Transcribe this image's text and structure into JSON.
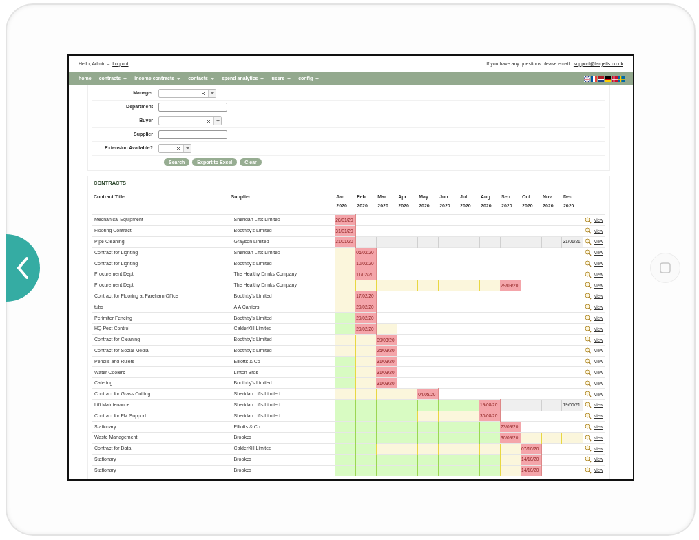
{
  "header": {
    "greeting": "Hello, Admin –",
    "logout": "Log out",
    "help_text": "If you have any questions please email:",
    "email": "support@targetis.co.uk"
  },
  "nav": [
    {
      "label": "home",
      "dropdown": false
    },
    {
      "label": "contracts",
      "dropdown": true
    },
    {
      "label": "income contracts",
      "dropdown": true
    },
    {
      "label": "contacts",
      "dropdown": true
    },
    {
      "label": "spend analytics",
      "dropdown": true
    },
    {
      "label": "users",
      "dropdown": true
    },
    {
      "label": "config",
      "dropdown": true
    }
  ],
  "filters": [
    {
      "label": "Manager",
      "kind": "select"
    },
    {
      "label": "Department",
      "kind": "text"
    },
    {
      "label": "Buyer",
      "kind": "select"
    },
    {
      "label": "Supplier",
      "kind": "text"
    },
    {
      "label": "Extension Available?",
      "kind": "short_select"
    }
  ],
  "buttons": [
    "Search",
    "Export to Excel",
    "Clear"
  ],
  "contracts": {
    "title": "CONTRACTS",
    "columns": [
      "Contract Title",
      "Supplier"
    ],
    "months": [
      {
        "month": "Jan",
        "year": "2020"
      },
      {
        "month": "Feb",
        "year": "2020"
      },
      {
        "month": "Mar",
        "year": "2020"
      },
      {
        "month": "Apr",
        "year": "2020"
      },
      {
        "month": "May",
        "year": "2020"
      },
      {
        "month": "Jun",
        "year": "2020"
      },
      {
        "month": "Jul",
        "year": "2020"
      },
      {
        "month": "Aug",
        "year": "2020"
      },
      {
        "month": "Sep",
        "year": "2020"
      },
      {
        "month": "Oct",
        "year": "2020"
      },
      {
        "month": "Nov",
        "year": "2020"
      },
      {
        "month": "Dec",
        "year": "2020"
      }
    ],
    "rows": [
      {
        "title": "Mechanical Equipment",
        "supplier": "Sheridan Lifts Limited",
        "cells": [
          {
            "color": "#f4a5aa",
            "text": "28/01/20"
          }
        ],
        "link": "view"
      },
      {
        "title": "Flooring Contract",
        "supplier": "Boothby's Limited",
        "cells": [
          {
            "color": "#f4a5aa",
            "text": "31/01/20"
          }
        ],
        "link": "view"
      },
      {
        "title": "Pipe Cleaning",
        "supplier": "Grayson Limited",
        "cells": [
          {
            "color": "#f4a5aa",
            "text": "31/01/20"
          },
          {
            "color": "#efefef"
          },
          {
            "color": "#efefef"
          },
          {
            "color": "#efefef"
          },
          {
            "color": "#efefef"
          },
          {
            "color": "#efefef"
          },
          {
            "color": "#efefef"
          },
          {
            "color": "#efefef"
          },
          {
            "color": "#efefef"
          },
          {
            "color": "#efefef"
          },
          {
            "color": "#efefef"
          },
          {
            "color": "#efefef",
            "text": "31/01/21"
          }
        ],
        "link": "view"
      },
      {
        "title": "Contract for Lighting",
        "supplier": "Sheridan Lifts Limited",
        "cells": [
          {
            "color": "#fbf6dc"
          },
          {
            "color": "#f4a5aa",
            "text": "06/02/20"
          }
        ],
        "link": "view"
      },
      {
        "title": "Contract for Lighting",
        "supplier": "Boothby's Limited",
        "cells": [
          {
            "color": "#fbf6dc"
          },
          {
            "color": "#f4a5aa",
            "text": "10/02/20"
          }
        ],
        "link": "view"
      },
      {
        "title": "Procurement Dept",
        "supplier": "The Healthy Drinks Company",
        "cells": [
          {
            "color": "#fbf6dc"
          },
          {
            "color": "#f4a5aa",
            "text": "11/02/20"
          }
        ],
        "link": "view"
      },
      {
        "title": "Procurement Dept",
        "supplier": "The Healthy Drinks Company",
        "cells": [
          {
            "color": "#fbf6dc"
          },
          {
            "color": "#fbf6dc"
          },
          {
            "color": "#fbf6dc"
          },
          {
            "color": "#fbf6dc"
          },
          {
            "color": "#fbf6dc"
          },
          {
            "color": "#fbf6dc"
          },
          {
            "color": "#fbf6dc"
          },
          {
            "color": "#fbf6dc"
          },
          {
            "color": "#f4a5aa",
            "text": "29/09/20"
          }
        ],
        "link": "view"
      },
      {
        "title": "Contract for Flooring at Fareham Office",
        "supplier": "Boothby's Limited",
        "cells": [
          {
            "color": "#fbf6dc"
          },
          {
            "color": "#f4a5aa",
            "text": "17/02/20"
          }
        ],
        "link": "view"
      },
      {
        "title": "tubs",
        "supplier": "A A Carriers",
        "cells": [
          {
            "color": "#fbf6dc"
          },
          {
            "color": "#f4a5aa",
            "text": "29/02/20"
          }
        ],
        "link": "view"
      },
      {
        "title": "Perimiter Fencing",
        "supplier": "Boothby's Limited",
        "cells": [
          {
            "color": "#d8fbc2"
          },
          {
            "color": "#f4a5aa",
            "text": "29/02/20"
          }
        ],
        "link": "view"
      },
      {
        "title": "HQ Pest Control",
        "supplier": "CalderKill Limited",
        "cells": [
          {
            "color": "#d8fbc2"
          },
          {
            "color": "#f4a5aa",
            "text": "29/02/20"
          },
          {
            "color": "#fbf6dc"
          }
        ],
        "link": "view"
      },
      {
        "title": "Contract for Cleaning",
        "supplier": "Boothby's Limited",
        "cells": [
          {
            "color": "#fbf6dc"
          },
          {
            "color": "#fbf6dc"
          },
          {
            "color": "#f4a5aa",
            "text": "09/03/20"
          }
        ],
        "link": "view"
      },
      {
        "title": "Contract for Social Media",
        "supplier": "Boothby's Limited",
        "cells": [
          {
            "color": "#fbf6dc"
          },
          {
            "color": "#fbf6dc"
          },
          {
            "color": "#f4a5aa",
            "text": "25/03/20"
          }
        ],
        "link": "view"
      },
      {
        "title": "Pencils and Rulers",
        "supplier": "Elliotts & Co",
        "cells": [
          {
            "color": "#d8fbc2"
          },
          {
            "color": "#fbf6dc"
          },
          {
            "color": "#f4a5aa",
            "text": "31/03/20"
          }
        ],
        "link": "view"
      },
      {
        "title": "Water Coolers",
        "supplier": "Linton Bros",
        "cells": [
          {
            "color": "#d8fbc2"
          },
          {
            "color": "#fbf6dc"
          },
          {
            "color": "#f4a5aa",
            "text": "31/03/20"
          }
        ],
        "link": "view"
      },
      {
        "title": "Catering",
        "supplier": "Boothby's Limited",
        "cells": [
          {
            "color": "#d8fbc2"
          },
          {
            "color": "#fbf6dc"
          },
          {
            "color": "#f4a5aa",
            "text": "31/03/20"
          }
        ],
        "link": "view"
      },
      {
        "title": "Contract for Grass Cutting",
        "supplier": "Sheridan Lifts Limited",
        "cells": [
          {
            "color": "#fbf6dc"
          },
          {
            "color": "#fbf6dc"
          },
          {
            "color": "#fbf6dc"
          },
          {
            "color": "#fbf6dc"
          },
          {
            "color": "#f4a5aa",
            "text": "04/05/20"
          }
        ],
        "link": "view"
      },
      {
        "title": "Lift Maintenance",
        "supplier": "Sheridan Lifts Limited",
        "cells": [
          {
            "color": "#d8fbc2"
          },
          {
            "color": "#d8fbc2"
          },
          {
            "color": "#d8fbc2"
          },
          {
            "color": "#d8fbc2"
          },
          {
            "color": "#d8fbc2"
          },
          {
            "color": "#d8fbc2"
          },
          {
            "color": "#d8fbc2"
          },
          {
            "color": "#f4a5aa",
            "text": "19/08/20"
          },
          {
            "color": "#efefef"
          },
          {
            "color": "#efefef"
          },
          {
            "color": "#efefef"
          },
          {
            "color": "#efefef",
            "text": "19/06/21"
          }
        ],
        "link": "view"
      },
      {
        "title": "Contract for FM Support",
        "supplier": "Sheridan Lifts Limited",
        "cells": [
          {
            "color": "#d8fbc2"
          },
          {
            "color": "#d8fbc2"
          },
          {
            "color": "#d8fbc2"
          },
          {
            "color": "#d8fbc2"
          },
          {
            "color": "#fbf6dc"
          },
          {
            "color": "#fbf6dc"
          },
          {
            "color": "#fbf6dc"
          },
          {
            "color": "#f4a5aa",
            "text": "30/08/20"
          }
        ],
        "link": "view"
      },
      {
        "title": "Stationary",
        "supplier": "Elliotts & Co",
        "cells": [
          {
            "color": "#d8fbc2"
          },
          {
            "color": "#d8fbc2"
          },
          {
            "color": "#d8fbc2"
          },
          {
            "color": "#d8fbc2"
          },
          {
            "color": "#d8fbc2"
          },
          {
            "color": "#d8fbc2"
          },
          {
            "color": "#d8fbc2"
          },
          {
            "color": "#d8fbc2"
          },
          {
            "color": "#f4a5aa",
            "text": "23/09/20"
          }
        ],
        "link": "view"
      },
      {
        "title": "Waste Management",
        "supplier": "Brookes",
        "cells": [
          {
            "color": "#d8fbc2"
          },
          {
            "color": "#d8fbc2"
          },
          {
            "color": "#d8fbc2"
          },
          {
            "color": "#d8fbc2"
          },
          {
            "color": "#d8fbc2"
          },
          {
            "color": "#d8fbc2"
          },
          {
            "color": "#d8fbc2"
          },
          {
            "color": "#d8fbc2"
          },
          {
            "color": "#f4a5aa",
            "text": "30/09/20"
          },
          {
            "color": "#fbf6dc"
          },
          {
            "color": "#fbf6dc"
          },
          {
            "color": "#fbf6dc"
          }
        ],
        "link": "view"
      },
      {
        "title": "Contract for Data",
        "supplier": "CalderKill Limited",
        "cells": [
          {
            "color": "#d8fbc2"
          },
          {
            "color": "#d8fbc2"
          },
          {
            "color": "#fbf6dc"
          },
          {
            "color": "#fbf6dc"
          },
          {
            "color": "#fbf6dc"
          },
          {
            "color": "#fbf6dc"
          },
          {
            "color": "#fbf6dc"
          },
          {
            "color": "#fbf6dc"
          },
          {
            "color": "#fbf6dc"
          },
          {
            "color": "#f4a5aa",
            "text": "07/10/20"
          }
        ],
        "link": "view"
      },
      {
        "title": "Stationary",
        "supplier": "Brookes",
        "cells": [
          {
            "color": "#d8fbc2"
          },
          {
            "color": "#d8fbc2"
          },
          {
            "color": "#d8fbc2"
          },
          {
            "color": "#d8fbc2"
          },
          {
            "color": "#d8fbc2"
          },
          {
            "color": "#d8fbc2"
          },
          {
            "color": "#d8fbc2"
          },
          {
            "color": "#d8fbc2"
          },
          {
            "color": "#fbf6dc"
          },
          {
            "color": "#f4a5aa",
            "text": "14/10/20"
          }
        ],
        "link": "view"
      },
      {
        "title": "Stationary",
        "supplier": "Brookes",
        "cells": [
          {
            "color": "#d8fbc2"
          },
          {
            "color": "#d8fbc2"
          },
          {
            "color": "#d8fbc2"
          },
          {
            "color": "#d8fbc2"
          },
          {
            "color": "#d8fbc2"
          },
          {
            "color": "#d8fbc2"
          },
          {
            "color": "#d8fbc2"
          },
          {
            "color": "#d8fbc2"
          },
          {
            "color": "#fbf6dc"
          },
          {
            "color": "#f4a5aa",
            "text": "14/10/20"
          }
        ],
        "link": "view"
      }
    ]
  }
}
